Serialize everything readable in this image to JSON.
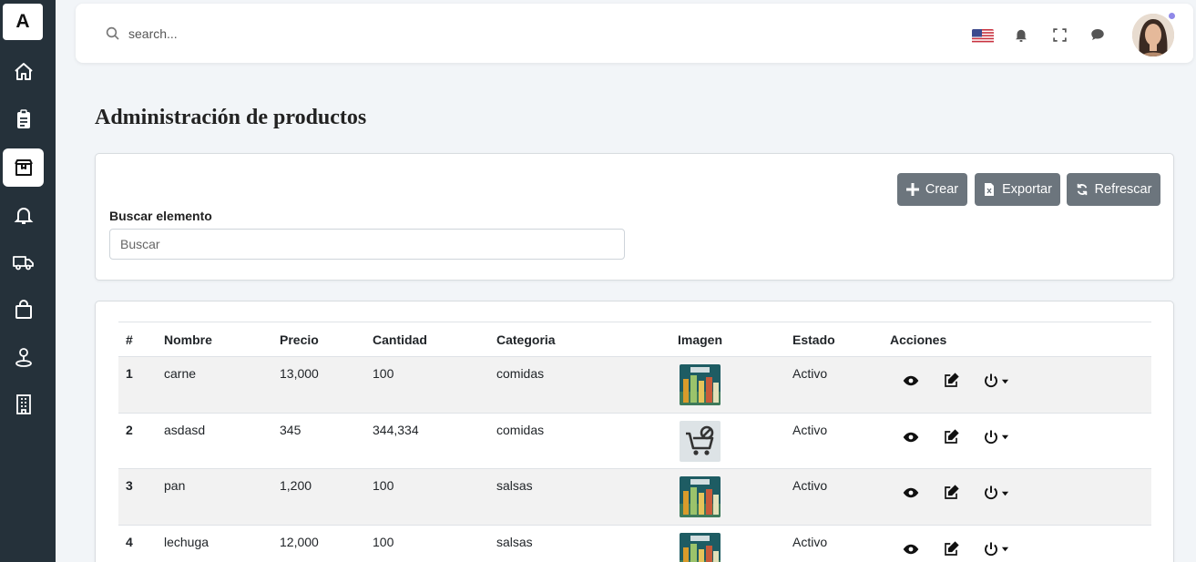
{
  "sidebar": {
    "logo": "A",
    "items": [
      {
        "icon": "home-icon"
      },
      {
        "icon": "clipboard-icon"
      },
      {
        "icon": "package-icon",
        "active": true
      },
      {
        "icon": "bell-icon"
      },
      {
        "icon": "truck-icon"
      },
      {
        "icon": "shopping-bag-icon"
      },
      {
        "icon": "map-pin-icon"
      },
      {
        "icon": "building-icon"
      }
    ]
  },
  "header": {
    "search_placeholder": "search...",
    "icons": [
      "us-flag-icon",
      "bell-icon",
      "fullscreen-icon",
      "chat-icon",
      "avatar"
    ]
  },
  "page": {
    "title": "Administración de productos"
  },
  "filter": {
    "buttons": {
      "create": "Crear",
      "export": "Exportar",
      "refresh": "Refrescar"
    },
    "label": "Buscar elemento",
    "placeholder": "Buscar"
  },
  "table": {
    "headers": [
      "#",
      "Nombre",
      "Precio",
      "Cantidad",
      "Categoria",
      "Imagen",
      "Estado",
      "Acciones"
    ],
    "rows": [
      {
        "id": "1",
        "name": "carne",
        "price": "13,000",
        "quantity": "100",
        "category": "comidas",
        "image": "product-photo",
        "status": "Activo"
      },
      {
        "id": "2",
        "name": "asdasd",
        "price": "345",
        "quantity": "344,334",
        "category": "comidas",
        "image": "no-image-cart",
        "status": "Activo"
      },
      {
        "id": "3",
        "name": "pan",
        "price": "1,200",
        "quantity": "100",
        "category": "salsas",
        "image": "product-photo",
        "status": "Activo"
      },
      {
        "id": "4",
        "name": "lechuga",
        "price": "12,000",
        "quantity": "100",
        "category": "salsas",
        "image": "product-photo",
        "status": "Activo"
      }
    ]
  },
  "colors": {
    "sidebar_bg": "#25313a",
    "button_bg": "#6c757d",
    "page_bg": "#f2f5f8"
  }
}
